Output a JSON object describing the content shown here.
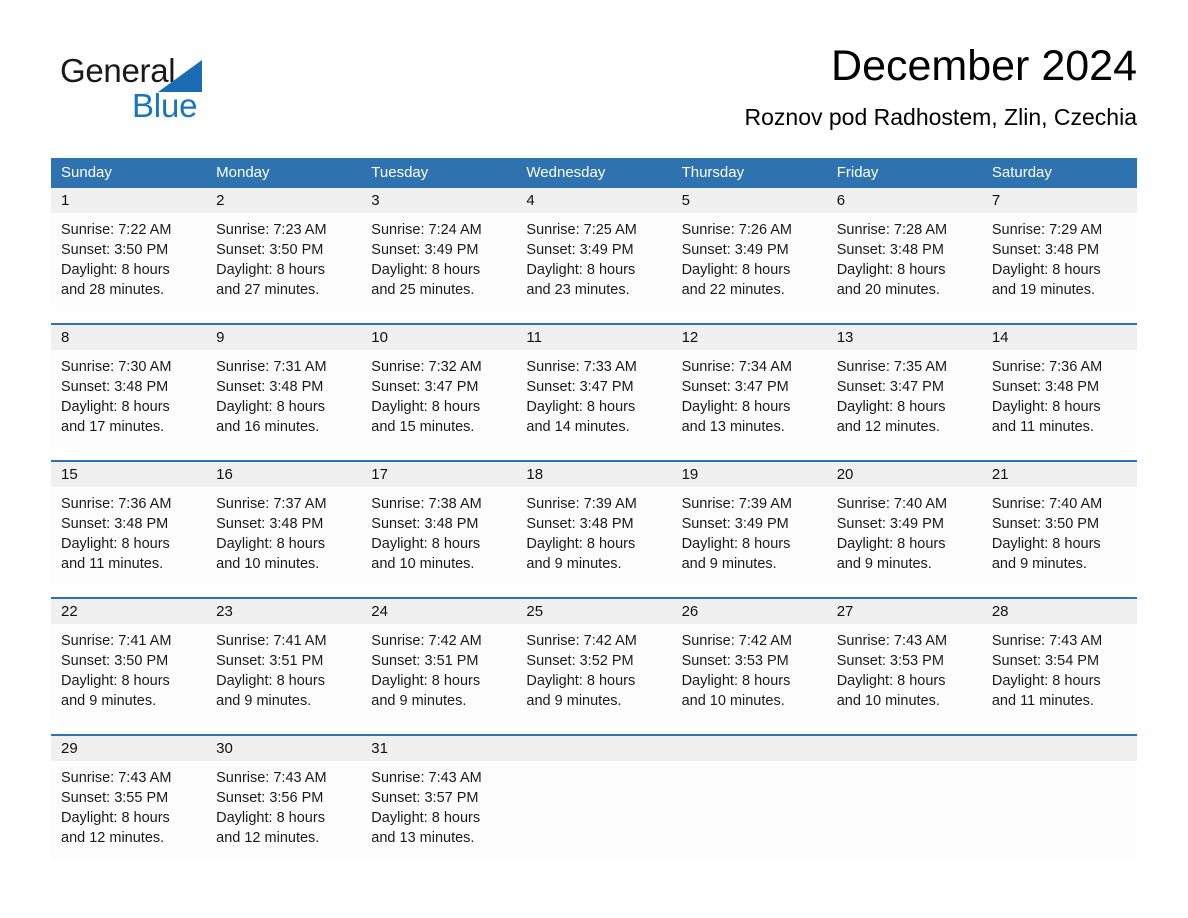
{
  "brand": {
    "name_part1": "General",
    "name_part2": "Blue",
    "triangle_color": "#1b6cb3",
    "blue_color": "#1b75bb"
  },
  "header": {
    "month_title": "December 2024",
    "location": "Roznov pod Radhostem, Zlin, Czechia"
  },
  "theme": {
    "header_blue": "#2e72b0",
    "day_band_gray": "#f0f0f0",
    "cell_white": "#fdfdfd"
  },
  "weekdays": [
    "Sunday",
    "Monday",
    "Tuesday",
    "Wednesday",
    "Thursday",
    "Friday",
    "Saturday"
  ],
  "weeks": [
    [
      {
        "day": "1",
        "sunrise": "Sunrise: 7:22 AM",
        "sunset": "Sunset: 3:50 PM",
        "daylight_line1": "Daylight: 8 hours",
        "daylight_line2": "and 28 minutes."
      },
      {
        "day": "2",
        "sunrise": "Sunrise: 7:23 AM",
        "sunset": "Sunset: 3:50 PM",
        "daylight_line1": "Daylight: 8 hours",
        "daylight_line2": "and 27 minutes."
      },
      {
        "day": "3",
        "sunrise": "Sunrise: 7:24 AM",
        "sunset": "Sunset: 3:49 PM",
        "daylight_line1": "Daylight: 8 hours",
        "daylight_line2": "and 25 minutes."
      },
      {
        "day": "4",
        "sunrise": "Sunrise: 7:25 AM",
        "sunset": "Sunset: 3:49 PM",
        "daylight_line1": "Daylight: 8 hours",
        "daylight_line2": "and 23 minutes."
      },
      {
        "day": "5",
        "sunrise": "Sunrise: 7:26 AM",
        "sunset": "Sunset: 3:49 PM",
        "daylight_line1": "Daylight: 8 hours",
        "daylight_line2": "and 22 minutes."
      },
      {
        "day": "6",
        "sunrise": "Sunrise: 7:28 AM",
        "sunset": "Sunset: 3:48 PM",
        "daylight_line1": "Daylight: 8 hours",
        "daylight_line2": "and 20 minutes."
      },
      {
        "day": "7",
        "sunrise": "Sunrise: 7:29 AM",
        "sunset": "Sunset: 3:48 PM",
        "daylight_line1": "Daylight: 8 hours",
        "daylight_line2": "and 19 minutes."
      }
    ],
    [
      {
        "day": "8",
        "sunrise": "Sunrise: 7:30 AM",
        "sunset": "Sunset: 3:48 PM",
        "daylight_line1": "Daylight: 8 hours",
        "daylight_line2": "and 17 minutes."
      },
      {
        "day": "9",
        "sunrise": "Sunrise: 7:31 AM",
        "sunset": "Sunset: 3:48 PM",
        "daylight_line1": "Daylight: 8 hours",
        "daylight_line2": "and 16 minutes."
      },
      {
        "day": "10",
        "sunrise": "Sunrise: 7:32 AM",
        "sunset": "Sunset: 3:47 PM",
        "daylight_line1": "Daylight: 8 hours",
        "daylight_line2": "and 15 minutes."
      },
      {
        "day": "11",
        "sunrise": "Sunrise: 7:33 AM",
        "sunset": "Sunset: 3:47 PM",
        "daylight_line1": "Daylight: 8 hours",
        "daylight_line2": "and 14 minutes."
      },
      {
        "day": "12",
        "sunrise": "Sunrise: 7:34 AM",
        "sunset": "Sunset: 3:47 PM",
        "daylight_line1": "Daylight: 8 hours",
        "daylight_line2": "and 13 minutes."
      },
      {
        "day": "13",
        "sunrise": "Sunrise: 7:35 AM",
        "sunset": "Sunset: 3:47 PM",
        "daylight_line1": "Daylight: 8 hours",
        "daylight_line2": "and 12 minutes."
      },
      {
        "day": "14",
        "sunrise": "Sunrise: 7:36 AM",
        "sunset": "Sunset: 3:48 PM",
        "daylight_line1": "Daylight: 8 hours",
        "daylight_line2": "and 11 minutes."
      }
    ],
    [
      {
        "day": "15",
        "sunrise": "Sunrise: 7:36 AM",
        "sunset": "Sunset: 3:48 PM",
        "daylight_line1": "Daylight: 8 hours",
        "daylight_line2": "and 11 minutes."
      },
      {
        "day": "16",
        "sunrise": "Sunrise: 7:37 AM",
        "sunset": "Sunset: 3:48 PM",
        "daylight_line1": "Daylight: 8 hours",
        "daylight_line2": "and 10 minutes."
      },
      {
        "day": "17",
        "sunrise": "Sunrise: 7:38 AM",
        "sunset": "Sunset: 3:48 PM",
        "daylight_line1": "Daylight: 8 hours",
        "daylight_line2": "and 10 minutes."
      },
      {
        "day": "18",
        "sunrise": "Sunrise: 7:39 AM",
        "sunset": "Sunset: 3:48 PM",
        "daylight_line1": "Daylight: 8 hours",
        "daylight_line2": "and 9 minutes."
      },
      {
        "day": "19",
        "sunrise": "Sunrise: 7:39 AM",
        "sunset": "Sunset: 3:49 PM",
        "daylight_line1": "Daylight: 8 hours",
        "daylight_line2": "and 9 minutes."
      },
      {
        "day": "20",
        "sunrise": "Sunrise: 7:40 AM",
        "sunset": "Sunset: 3:49 PM",
        "daylight_line1": "Daylight: 8 hours",
        "daylight_line2": "and 9 minutes."
      },
      {
        "day": "21",
        "sunrise": "Sunrise: 7:40 AM",
        "sunset": "Sunset: 3:50 PM",
        "daylight_line1": "Daylight: 8 hours",
        "daylight_line2": "and 9 minutes."
      }
    ],
    [
      {
        "day": "22",
        "sunrise": "Sunrise: 7:41 AM",
        "sunset": "Sunset: 3:50 PM",
        "daylight_line1": "Daylight: 8 hours",
        "daylight_line2": "and 9 minutes."
      },
      {
        "day": "23",
        "sunrise": "Sunrise: 7:41 AM",
        "sunset": "Sunset: 3:51 PM",
        "daylight_line1": "Daylight: 8 hours",
        "daylight_line2": "and 9 minutes."
      },
      {
        "day": "24",
        "sunrise": "Sunrise: 7:42 AM",
        "sunset": "Sunset: 3:51 PM",
        "daylight_line1": "Daylight: 8 hours",
        "daylight_line2": "and 9 minutes."
      },
      {
        "day": "25",
        "sunrise": "Sunrise: 7:42 AM",
        "sunset": "Sunset: 3:52 PM",
        "daylight_line1": "Daylight: 8 hours",
        "daylight_line2": "and 9 minutes."
      },
      {
        "day": "26",
        "sunrise": "Sunrise: 7:42 AM",
        "sunset": "Sunset: 3:53 PM",
        "daylight_line1": "Daylight: 8 hours",
        "daylight_line2": "and 10 minutes."
      },
      {
        "day": "27",
        "sunrise": "Sunrise: 7:43 AM",
        "sunset": "Sunset: 3:53 PM",
        "daylight_line1": "Daylight: 8 hours",
        "daylight_line2": "and 10 minutes."
      },
      {
        "day": "28",
        "sunrise": "Sunrise: 7:43 AM",
        "sunset": "Sunset: 3:54 PM",
        "daylight_line1": "Daylight: 8 hours",
        "daylight_line2": "and 11 minutes."
      }
    ],
    [
      {
        "day": "29",
        "sunrise": "Sunrise: 7:43 AM",
        "sunset": "Sunset: 3:55 PM",
        "daylight_line1": "Daylight: 8 hours",
        "daylight_line2": "and 12 minutes."
      },
      {
        "day": "30",
        "sunrise": "Sunrise: 7:43 AM",
        "sunset": "Sunset: 3:56 PM",
        "daylight_line1": "Daylight: 8 hours",
        "daylight_line2": "and 12 minutes."
      },
      {
        "day": "31",
        "sunrise": "Sunrise: 7:43 AM",
        "sunset": "Sunset: 3:57 PM",
        "daylight_line1": "Daylight: 8 hours",
        "daylight_line2": "and 13 minutes."
      },
      {
        "day": "",
        "sunrise": "",
        "sunset": "",
        "daylight_line1": "",
        "daylight_line2": ""
      },
      {
        "day": "",
        "sunrise": "",
        "sunset": "",
        "daylight_line1": "",
        "daylight_line2": ""
      },
      {
        "day": "",
        "sunrise": "",
        "sunset": "",
        "daylight_line1": "",
        "daylight_line2": ""
      },
      {
        "day": "",
        "sunrise": "",
        "sunset": "",
        "daylight_line1": "",
        "daylight_line2": ""
      }
    ]
  ]
}
